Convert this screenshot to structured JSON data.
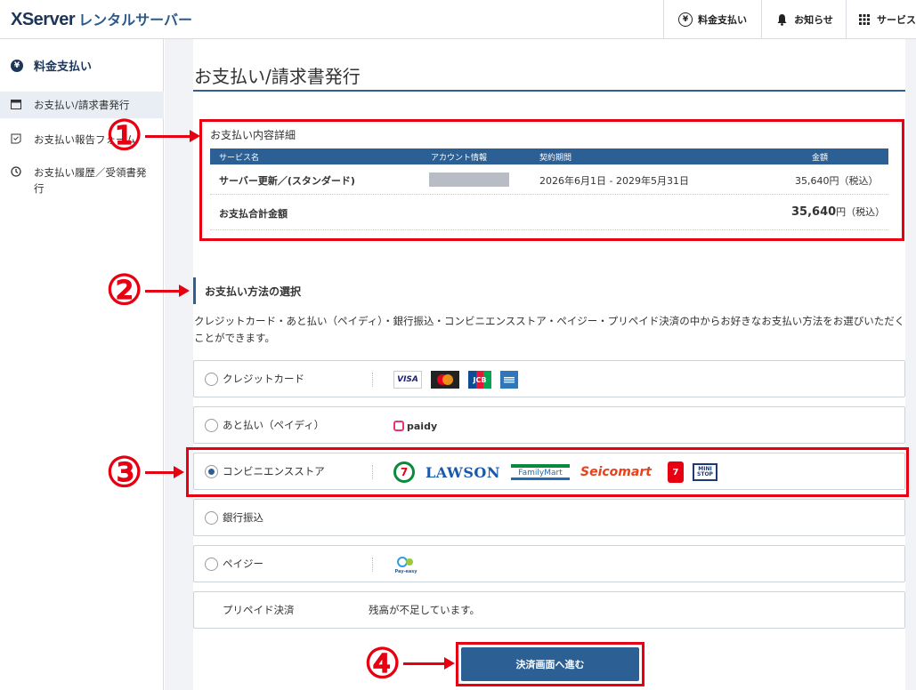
{
  "header": {
    "logo_main": "XServer",
    "logo_sub": "レンタルサーバー",
    "nav": [
      {
        "icon": "yen-circle-icon",
        "label": "料金支払い"
      },
      {
        "icon": "bell-icon",
        "label": "お知らせ"
      },
      {
        "icon": "grid-icon",
        "label": "サービス"
      }
    ]
  },
  "sidebar": {
    "title": "料金支払い",
    "items": [
      {
        "icon": "invoice-icon",
        "label": "お支払い/請求書発行"
      },
      {
        "icon": "report-form-icon",
        "label": "お支払い報告フォーム"
      },
      {
        "icon": "history-clock-icon",
        "label": "お支払い履歴／受領書発行"
      }
    ]
  },
  "page": {
    "title": "お支払い/請求書発行"
  },
  "details": {
    "title": "お支払い内容詳細",
    "columns": [
      "サービス名",
      "アカウント情報",
      "契約期間",
      "金額"
    ],
    "row": {
      "service": "サーバー更新／(スタンダード)",
      "period": "2026年6月1日 - 2029年5月31日",
      "amount": "35,640円（税込）"
    },
    "total_label": "お支払合計金額",
    "total_amount": "35,640",
    "total_suffix": "円（税込）"
  },
  "method": {
    "title": "お支払い方法の選択",
    "description": "クレジットカード・あと払い（ペイディ）・銀行振込・コンビニエンスストア・ペイジー・プリペイド決済の中からお好きなお支払い方法をお選びいただくことができます。",
    "options": [
      {
        "label": "クレジットカード",
        "selected": false
      },
      {
        "label": "あと払い（ペイディ）",
        "selected": false
      },
      {
        "label": "コンビニエンスストア",
        "selected": true
      },
      {
        "label": "銀行振込",
        "selected": false
      },
      {
        "label": "ペイジー",
        "selected": false
      },
      {
        "label": "プリペイド決済",
        "selected": false,
        "note": "残高が不足しています。"
      }
    ],
    "card_brands": [
      "VISA",
      "JCB"
    ],
    "paidy_text": "paidy",
    "stores": [
      "LAWSON",
      "FamilyMart",
      "Seicomart"
    ],
    "store_badges": {
      "seven": "7",
      "ministop": "MINI STOP"
    },
    "payeasy_text": "Pay-easy"
  },
  "submit_label": "決済画面へ進む",
  "annotations": [
    "①",
    "②",
    "③",
    "④"
  ],
  "colors": {
    "accent": "#2c5f94",
    "annotation": "#e60012"
  }
}
